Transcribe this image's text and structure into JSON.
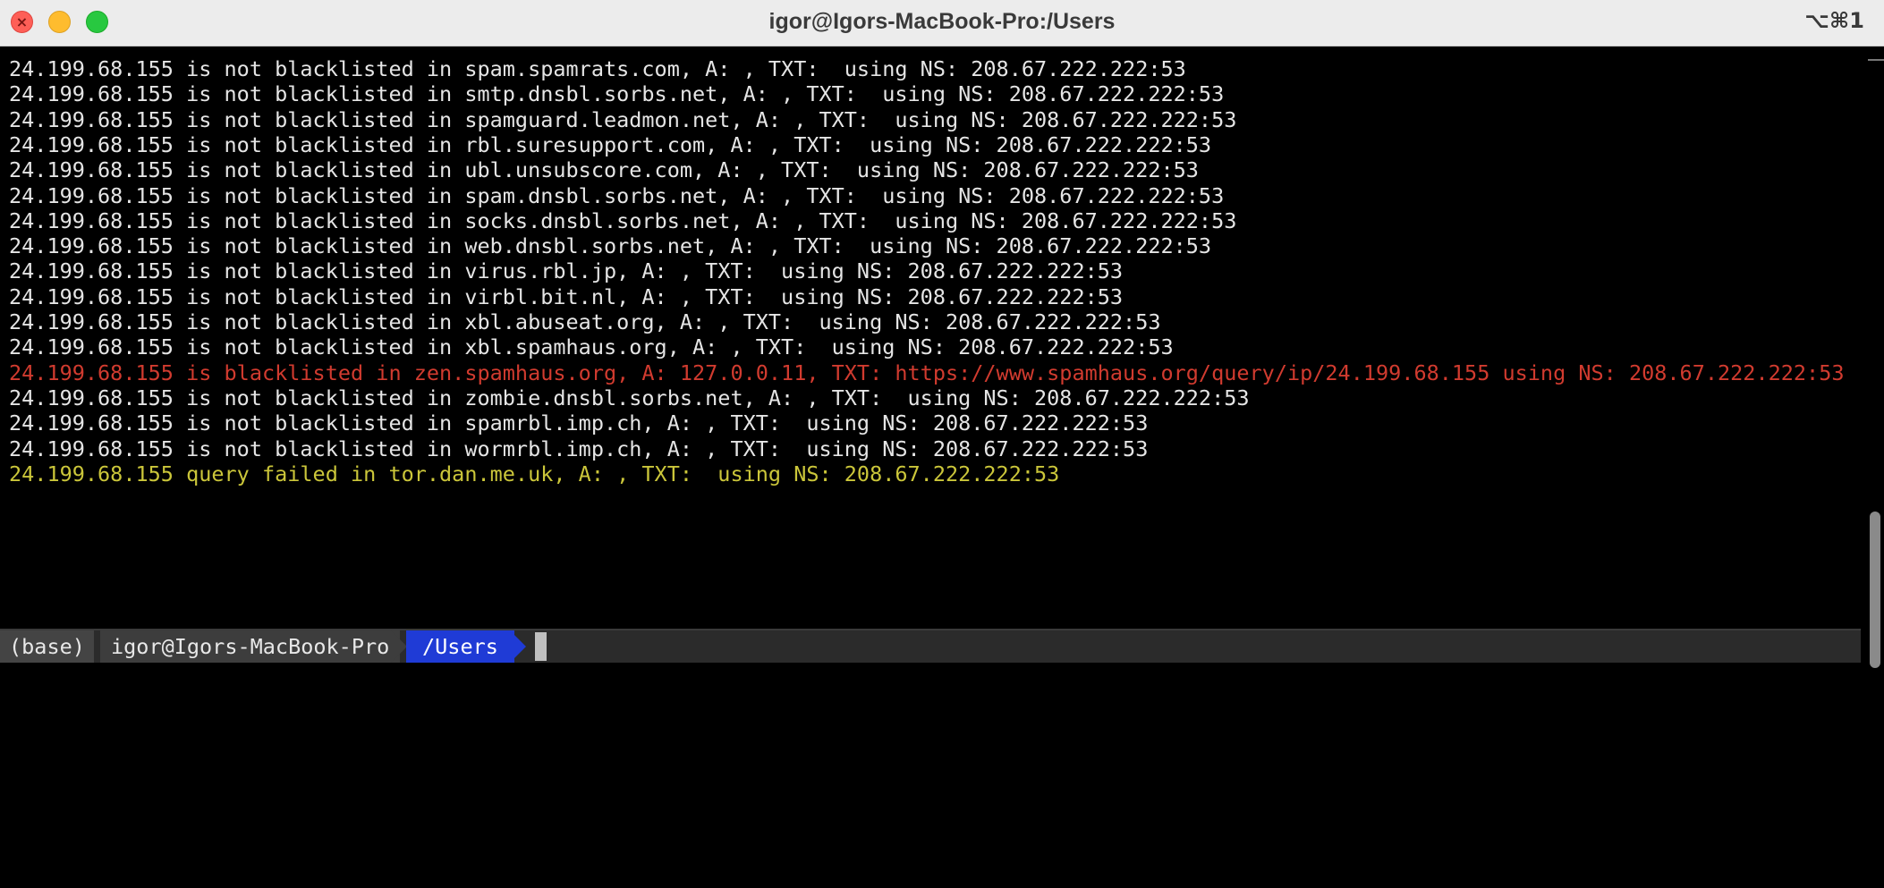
{
  "window": {
    "title": "igor@Igors-MacBook-Pro:/Users",
    "shortcut": "⌥⌘1",
    "close_glyph": "×"
  },
  "terminal": {
    "lines": [
      {
        "text": "24.199.68.155 is not blacklisted in spam.spamrats.com, A: , TXT:  using NS: 208.67.222.222:53",
        "status": "ok"
      },
      {
        "text": "24.199.68.155 is not blacklisted in smtp.dnsbl.sorbs.net, A: , TXT:  using NS: 208.67.222.222:53",
        "status": "ok"
      },
      {
        "text": "24.199.68.155 is not blacklisted in spamguard.leadmon.net, A: , TXT:  using NS: 208.67.222.222:53",
        "status": "ok"
      },
      {
        "text": "24.199.68.155 is not blacklisted in rbl.suresupport.com, A: , TXT:  using NS: 208.67.222.222:53",
        "status": "ok"
      },
      {
        "text": "24.199.68.155 is not blacklisted in ubl.unsubscore.com, A: , TXT:  using NS: 208.67.222.222:53",
        "status": "ok"
      },
      {
        "text": "24.199.68.155 is not blacklisted in spam.dnsbl.sorbs.net, A: , TXT:  using NS: 208.67.222.222:53",
        "status": "ok"
      },
      {
        "text": "24.199.68.155 is not blacklisted in socks.dnsbl.sorbs.net, A: , TXT:  using NS: 208.67.222.222:53",
        "status": "ok"
      },
      {
        "text": "24.199.68.155 is not blacklisted in web.dnsbl.sorbs.net, A: , TXT:  using NS: 208.67.222.222:53",
        "status": "ok"
      },
      {
        "text": "24.199.68.155 is not blacklisted in virus.rbl.jp, A: , TXT:  using NS: 208.67.222.222:53",
        "status": "ok"
      },
      {
        "text": "24.199.68.155 is not blacklisted in virbl.bit.nl, A: , TXT:  using NS: 208.67.222.222:53",
        "status": "ok"
      },
      {
        "text": "24.199.68.155 is not blacklisted in xbl.abuseat.org, A: , TXT:  using NS: 208.67.222.222:53",
        "status": "ok"
      },
      {
        "text": "24.199.68.155 is not blacklisted in xbl.spamhaus.org, A: , TXT:  using NS: 208.67.222.222:53",
        "status": "ok"
      },
      {
        "text": "24.199.68.155 is blacklisted in zen.spamhaus.org, A: 127.0.0.11, TXT: https://www.spamhaus.org/query/ip/24.199.68.155 using NS: 208.67.222.222:53",
        "status": "blacklisted"
      },
      {
        "text": "24.199.68.155 is not blacklisted in zombie.dnsbl.sorbs.net, A: , TXT:  using NS: 208.67.222.222:53",
        "status": "ok"
      },
      {
        "text": "24.199.68.155 is not blacklisted in spamrbl.imp.ch, A: , TXT:  using NS: 208.67.222.222:53",
        "status": "ok"
      },
      {
        "text": "24.199.68.155 is not blacklisted in wormrbl.imp.ch, A: , TXT:  using NS: 208.67.222.222:53",
        "status": "ok"
      },
      {
        "text": "24.199.68.155 query failed in tor.dan.me.uk, A: , TXT:  using NS: 208.67.222.222:53",
        "status": "failed"
      }
    ]
  },
  "prompt": {
    "env": "(base)",
    "host": "igor@Igors-MacBook-Pro",
    "dir": "/Users"
  },
  "colors": {
    "ok": "#e5e5e5",
    "blacklisted": "#d13b2f",
    "failed": "#cbc63a",
    "dir_segment": "#1f3bd6"
  }
}
